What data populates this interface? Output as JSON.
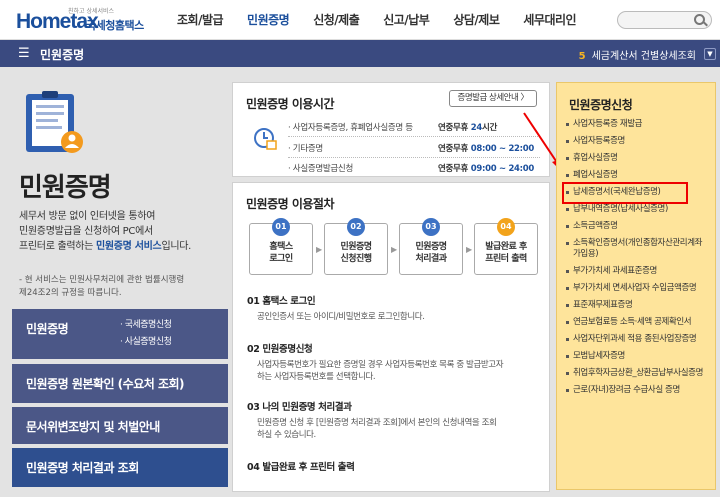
{
  "header": {
    "logo_small": "친하고 상세서비스",
    "logo_main": "Hometax",
    "logo_kor": "국세청홈택스",
    "nav": [
      "조회/발급",
      "민원증명",
      "신청/제출",
      "신고/납부",
      "상담/제보",
      "세무대리인"
    ],
    "active_nav": "민원증명",
    "search_placeholder": ""
  },
  "bar": {
    "menu_icon": "☰",
    "title": "민원증명",
    "ticker_num": "5",
    "ticker_text": "세금계산서 건별상세조회",
    "ctrl_icon": "▼"
  },
  "left": {
    "title": "민원증명",
    "desc_1": "세무서 방문 없이 인터넷을 통하여",
    "desc_2": "민원증명발급을 신청하여 PC에서",
    "desc_3a": "프린터로 출력하는 ",
    "desc_3b": "민원증명 서비스",
    "desc_3c": "입니다.",
    "note_1": "- 현 서비스는 민원사무처리에 관한 법률시행령",
    "note_2": "제24조2의 규정을 따릅니다.",
    "btn1": "민원증명",
    "btn1_sub1": "· 국세증명신청",
    "btn1_sub2": "· 사실증명신청",
    "btn2": "민원증명 원본확인 (수요처 조회)",
    "btn3": "문서위변조방지 및 처벌안내",
    "btn4": "민원증명 처리결과 조회"
  },
  "hours": {
    "title": "민원증명 이용시간",
    "detail_btn": "증명발급 상세안내 〉",
    "rows": [
      {
        "label": "· 사업자등록증명, 휴폐업사실증명 등",
        "value_a": "연중무휴 ",
        "value_b": "24",
        "value_c": "시간"
      },
      {
        "label": "· 기타증명",
        "value_a": "연중무휴 ",
        "value_b": "08:00 ~ 22:00",
        "value_c": ""
      },
      {
        "label": "· 사실증명발급신청",
        "value_a": "연중무휴 ",
        "value_b": "09:00 ~ 24:00",
        "value_c": ""
      }
    ]
  },
  "procedure": {
    "title": "민원증명 이용절차",
    "steps": [
      {
        "num": "01",
        "line1": "홈택스",
        "line2": "로그인",
        "color": "#3d72c4"
      },
      {
        "num": "02",
        "line1": "민원증명",
        "line2": "신청진행",
        "color": "#3d72c4"
      },
      {
        "num": "03",
        "line1": "민원증명",
        "line2": "처리결과",
        "color": "#3d72c4"
      },
      {
        "num": "04",
        "line1": "발급완료 후",
        "line2": "프린터 출력",
        "color": "#f2a31b"
      }
    ],
    "sections": [
      {
        "title": "01 홈택스 로그인",
        "d1": "공인인증서 또는 아이디/비밀번호로 로그인합니다.",
        "d2": ""
      },
      {
        "title": "02 민원증명신청",
        "d1": "사업자등록번호가 필요한 증명일 경우 사업자등록번호 목록 중 발급받고자",
        "d2": "하는 사업자등록번호를 선택합니다."
      },
      {
        "title": "03 나의 민원증명 처리결과",
        "d1": "민원증명 신청 후 [민원증명 처리결과 조회]에서 본인의 신청내역을 조회",
        "d2": "하실 수 있습니다."
      },
      {
        "title": "04 발급완료 후 프린터 출력",
        "d1": "",
        "d2": ""
      }
    ]
  },
  "right": {
    "title": "민원증명신청",
    "items": [
      "사업자등록증 재발급",
      "사업자등록증명",
      "휴업사실증명",
      "폐업사실증명",
      "납세증명서(국세완납증명)",
      "납부내역증명(납세사실증명)",
      "소득금액증명",
      "소득확인증명서(개인종합자산관리계좌 가입용)",
      "부가가치세 과세표준증명",
      "부가가치세 면세사업자 수입금액증명",
      "표준재무제표증명",
      "연금보험료등 소득·세액 공제확인서",
      "사업자단위과세 적용 종된사업장증명",
      "모범납세자증명",
      "취업후학자금상환_상환금납부사실증명",
      "근로(자녀)장려금 수급사실 증명"
    ],
    "highlight_index": 4
  },
  "colors": {
    "nav_bar": "#3a4a80",
    "left_btn": "#4b5787",
    "left_btn_active": "#2e4f8f",
    "right_panel": "#fee49b",
    "highlight": "#e00000"
  }
}
